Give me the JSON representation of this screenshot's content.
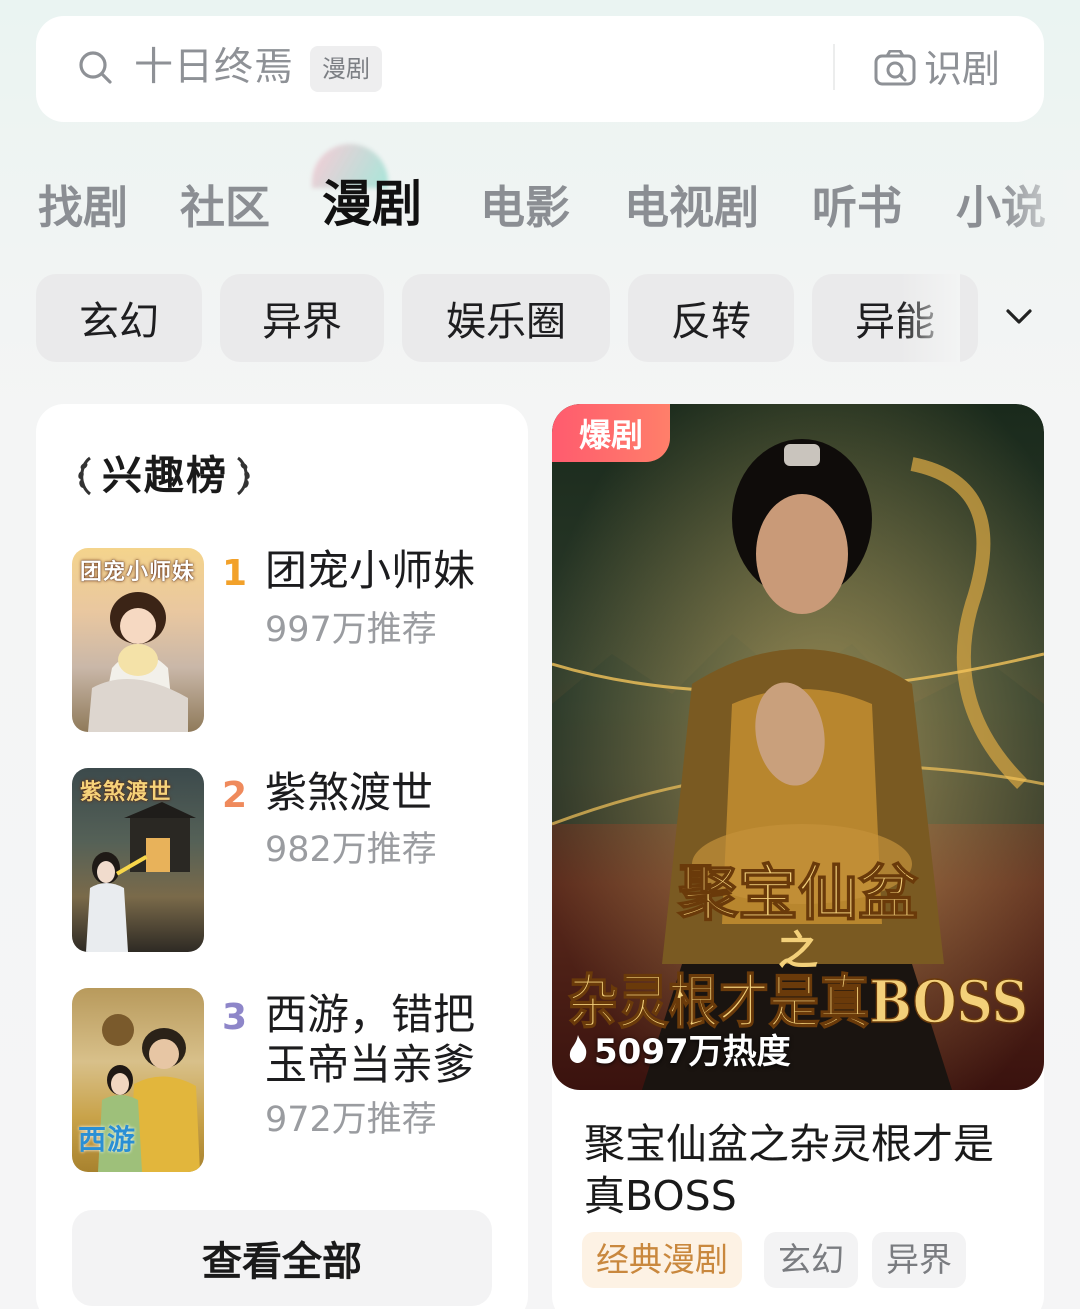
{
  "search": {
    "query": "十日终焉",
    "tag": "漫剧",
    "scan_label": "识剧"
  },
  "tabs": [
    {
      "label": "找剧",
      "active": false
    },
    {
      "label": "社区",
      "active": false
    },
    {
      "label": "漫剧",
      "active": true
    },
    {
      "label": "电影",
      "active": false
    },
    {
      "label": "电视剧",
      "active": false
    },
    {
      "label": "听书",
      "active": false
    },
    {
      "label": "小说",
      "active": false
    }
  ],
  "genres": [
    "玄幻",
    "异界",
    "娱乐圈",
    "反转",
    "异能"
  ],
  "ranking": {
    "title": "兴趣榜",
    "items": [
      {
        "rank": "1",
        "name": "团宠小师妹",
        "count": "997万推荐",
        "cover_text": "团宠小师妹",
        "rank_color": "#f2a12a"
      },
      {
        "rank": "2",
        "name": "紫煞渡世",
        "count": "982万推荐",
        "cover_text": "紫煞渡世",
        "rank_color": "#ef8a5c"
      },
      {
        "rank": "3",
        "name": "西游，错把玉帝当亲爹",
        "count": "972万推荐",
        "cover_text": "西游",
        "rank_color": "#8e86c9"
      }
    ],
    "view_all": "查看全部"
  },
  "feature": {
    "badge": "爆剧",
    "poster_title_line1": "聚宝仙盆",
    "poster_title_mid": "之",
    "poster_title_line2": "杂灵根才是真BOSS",
    "heat": "5097万热度",
    "title": "聚宝仙盆之杂灵根才是真BOSS",
    "tags": [
      "经典漫剧",
      "玄幻",
      "异界"
    ]
  }
}
